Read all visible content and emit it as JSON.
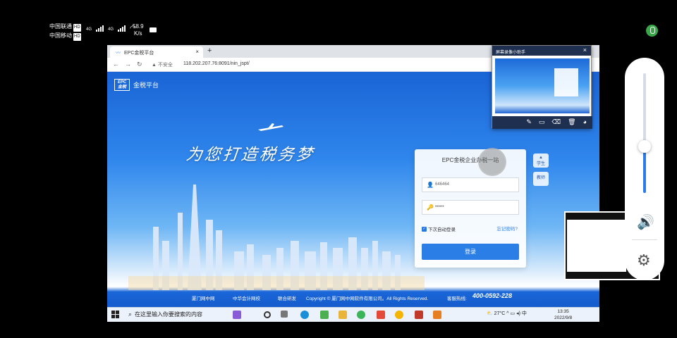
{
  "phone": {
    "carrier1": "中国联通",
    "carrier2": "中国移动",
    "hd": "HD",
    "net1": "4G",
    "net2": "4G",
    "speed_value": "58.9",
    "speed_unit": "K/s"
  },
  "browser": {
    "tab_title": "EPC金税平台",
    "new_tab": "+",
    "close": "×",
    "insecure_label": "不安全",
    "url": "118.202.207.76:8091/nin_jspt/"
  },
  "page": {
    "logo_mark": "EPC",
    "logo_sub": "金税",
    "logo_text": "金税平台",
    "slogan": "为您打造税务梦",
    "login": {
      "title": "EPC金税企业办税一站",
      "username_value": "646464",
      "password_value": "••••••",
      "remember_label": "下次自动登录",
      "forgot_label": "忘记密码?",
      "login_button": "登录"
    },
    "side_tabs": [
      "学生",
      "教师"
    ],
    "footer": {
      "brand1": "厦门网中网",
      "brand2": "中华会计网校",
      "joint": "联合研发",
      "copyright": "Copyright © 厦门网中网软件有限公司。All Rights Reserved.",
      "hotline_label": "客服热线:",
      "hotline": "400-0592-228"
    }
  },
  "taskbar": {
    "search_placeholder": "在这里输入你要搜索的内容",
    "weather": "27°C",
    "ime": "中",
    "time": "13:35",
    "date": "2022/9/8"
  },
  "annotation": {
    "title": "屏幕录像小助手",
    "close": "×"
  }
}
